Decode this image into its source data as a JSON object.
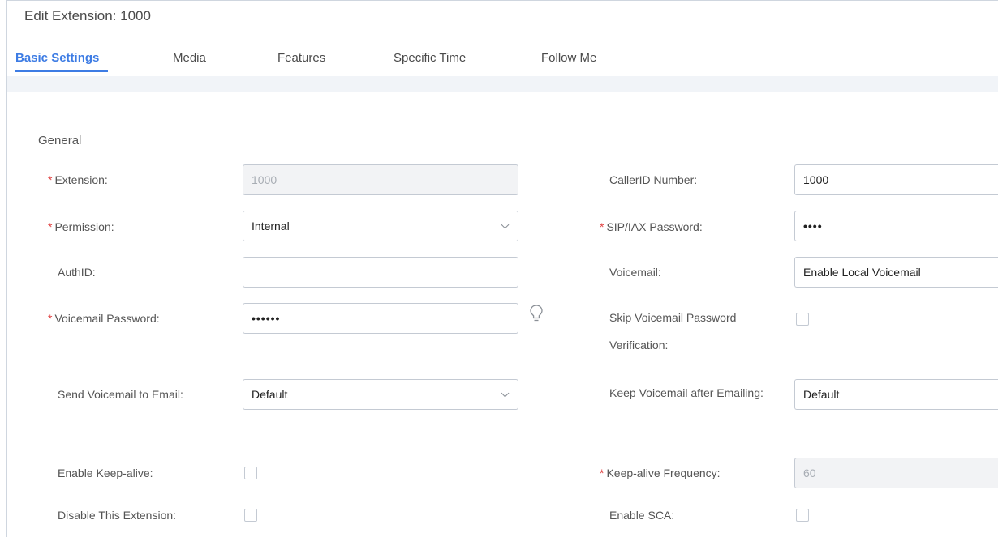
{
  "dialog": {
    "title": "Edit Extension: 1000"
  },
  "tabs": [
    {
      "label": "Basic Settings",
      "active": true
    },
    {
      "label": "Media"
    },
    {
      "label": "Features"
    },
    {
      "label": "Specific Time"
    },
    {
      "label": "Follow Me"
    }
  ],
  "section": {
    "title": "General"
  },
  "fields": {
    "extension": {
      "label": "Extension:",
      "required": true,
      "value": "1000",
      "disabled": true
    },
    "permission": {
      "label": "Permission:",
      "required": true,
      "value": "Internal"
    },
    "authid": {
      "label": "AuthID:",
      "value": ""
    },
    "voicemail_password": {
      "label": "Voicemail Password:",
      "required": true,
      "value": "••••••",
      "icon": "lightbulb-icon"
    },
    "send_voicemail_email": {
      "label": "Send Voicemail to Email:",
      "value": "Default"
    },
    "enable_keepalive": {
      "label": "Enable Keep-alive:",
      "checked": false
    },
    "disable_extension": {
      "label": "Disable This Extension:",
      "checked": false
    },
    "callerid_number": {
      "label": "CallerID Number:",
      "value": "1000"
    },
    "sip_password": {
      "label": "SIP/IAX Password:",
      "required": true,
      "value": "••••"
    },
    "voicemail": {
      "label": "Voicemail:",
      "value": "Enable Local Voicemail"
    },
    "skip_vm_verification": {
      "label": "Skip Voicemail Password Verification:",
      "checked": false
    },
    "keep_vm_after_email": {
      "label": "Keep Voicemail after Emailing:",
      "value": "Default"
    },
    "keepalive_frequency": {
      "label": "Keep-alive Frequency:",
      "required": true,
      "value": "60",
      "disabled": true
    },
    "enable_sca": {
      "label": "Enable SCA:",
      "checked": false
    }
  },
  "colors": {
    "accent": "#3d7ce4",
    "required_star": "#e04040",
    "border": "#c4cad3"
  }
}
